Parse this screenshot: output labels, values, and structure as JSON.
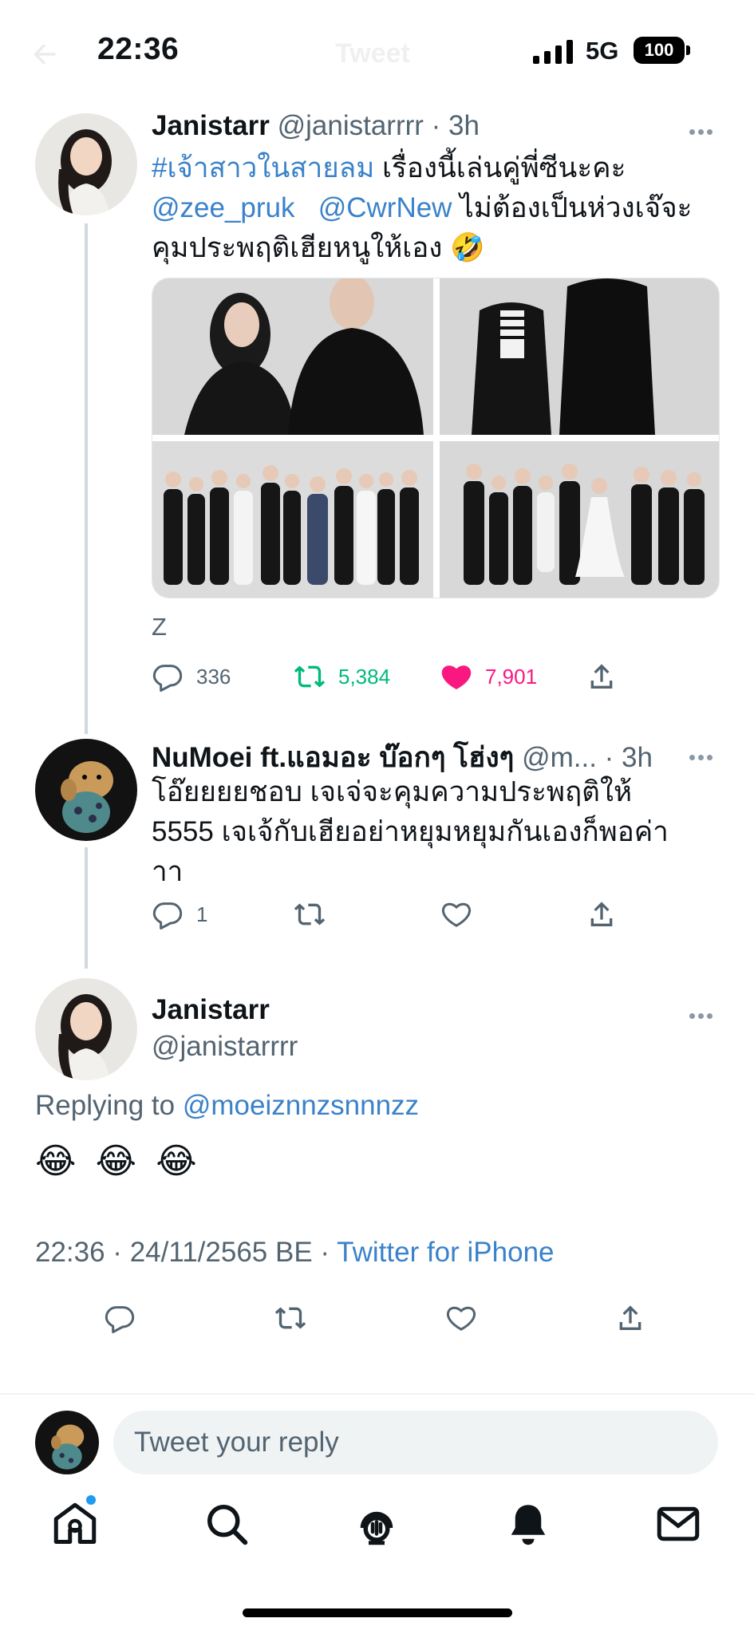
{
  "status_bar": {
    "time": "22:36",
    "network": "5G",
    "battery": "100"
  },
  "header": {
    "title": "Tweet"
  },
  "tweets": [
    {
      "name": "Janistarr",
      "handle": "@janistarrrr",
      "dot_time": "· 3h",
      "text": {
        "hashtag": "#เจ้าสาวในสายลม",
        "line1_rest": " เรื่องนี้เล่นคู่พี่ซีนะคะ",
        "mention1": "@zee_pruk",
        "mention2": "@CwrNew",
        "line2_rest": " ไม่ต้องเป็นห่วงเจ๊จะ",
        "line3": "คุมประพฤติเฮียหนูให้เอง 🤣"
      },
      "caption": "Z",
      "stats": {
        "replies": "336",
        "retweets": "5,384",
        "likes": "7,901"
      }
    },
    {
      "name": "NuMoei ft.แอมอะ บ๊อกๆ โฮ่งๆ",
      "handle": "@m...",
      "dot_time": "· 3h",
      "text": {
        "line1": "โอ๊ยยยยชอบ เจเจ่จะคุมความประพฤติให้",
        "line2": "5555 เจเจ้กับเฮียอย่าหยุมหยุมกันเองก็พอค่า",
        "line3": "าา"
      },
      "stats": {
        "replies": "1"
      }
    }
  ],
  "main_tweet": {
    "name": "Janistarr",
    "handle": "@janistarrrr",
    "replying_label": "Replying to",
    "replying_handle": "@moeiznnzsnnnzz",
    "emojis": "😂 😂 😂",
    "timestamp": "22:36 · 24/11/2565 BE · ",
    "source": "Twitter for iPhone"
  },
  "composer": {
    "placeholder": "Tweet your reply"
  },
  "tabbar": {
    "items": [
      "home-icon",
      "search-icon",
      "spaces-icon",
      "notifications-icon",
      "messages-icon"
    ]
  },
  "colors": {
    "link": "#1d9bf0",
    "retweet": "#00ba7c",
    "like": "#f91880",
    "muted": "#536471"
  }
}
